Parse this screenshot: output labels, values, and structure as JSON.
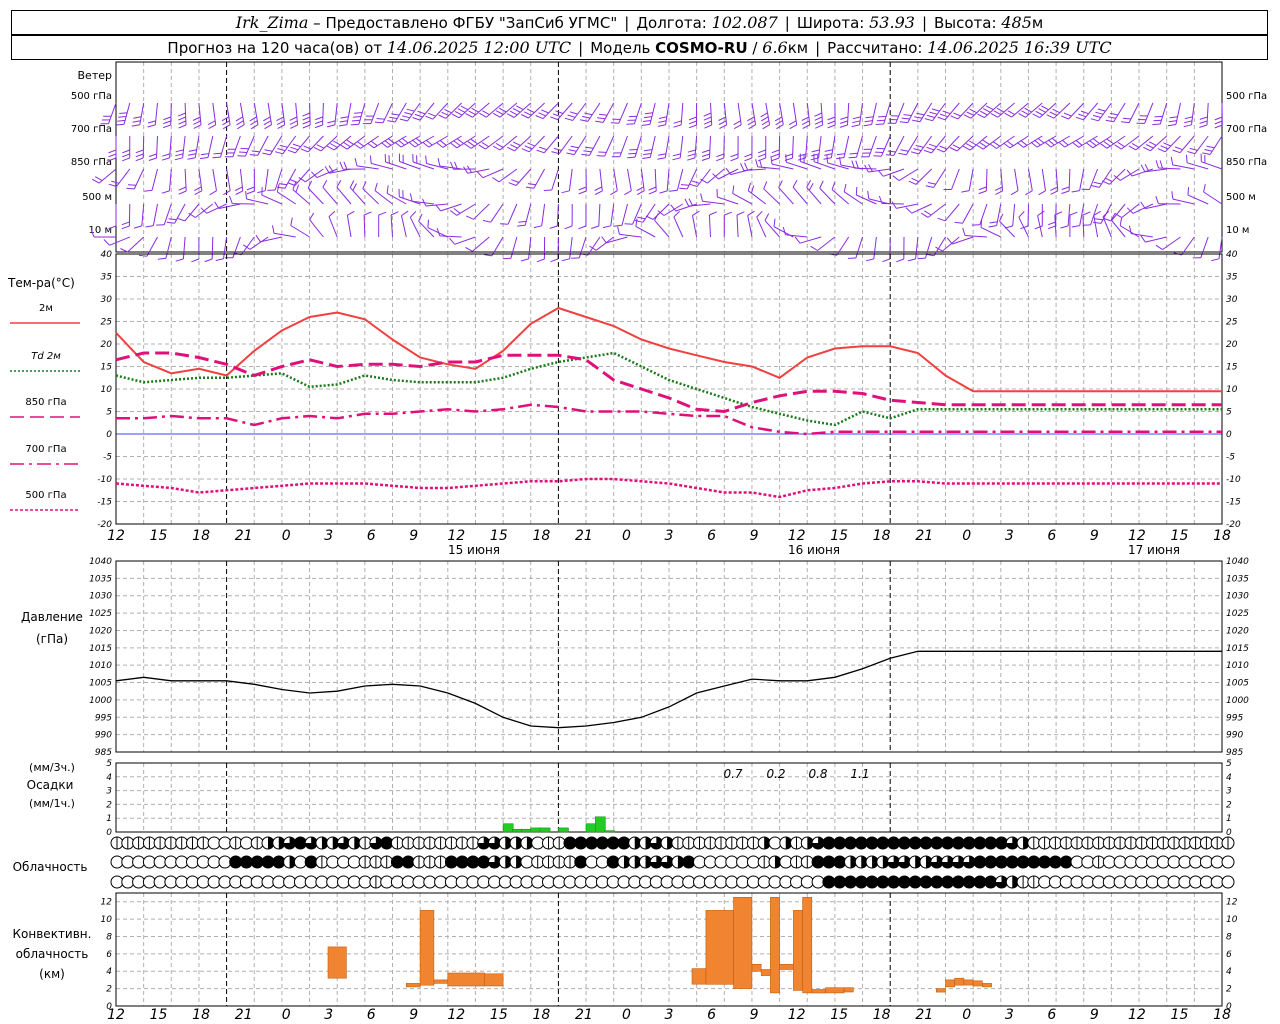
{
  "header": {
    "station": "Irk_Zima",
    "dash": "–",
    "provider": "Предоставлено ФГБУ \"ЗапСиб УГМС\"",
    "lon_label": "Долгота:",
    "lon_value": "102.087",
    "lat_label": "Широта:",
    "lat_value": "53.93",
    "alt_label": "Высота:",
    "alt_value": "485",
    "alt_unit": "м",
    "forecast_prefix": "Прогноз на 120 часа(ов)  от",
    "forecast_start": "14.06.2025 12:00 UTC",
    "model_label": "Модель",
    "model_name": "COSMO-RU",
    "model_slash": "/",
    "model_res": "6.6",
    "model_res_unit": "км",
    "computed_label": "Рассчитано:",
    "computed_value": "14.06.2025 16:39 UTC"
  },
  "colors": {
    "wind": "#8a2be2",
    "t2m": "#f04040",
    "td2m": "#1a7a1a",
    "t850": "#e0107a",
    "t700": "#e0107a",
    "t500": "#e0107a",
    "zero_line": "#4040ff",
    "pressure": "#000000",
    "precip": "#22cc22",
    "convective": "#f08430",
    "grid": "#b0b0b0"
  },
  "time_axis": {
    "hour_labels": [
      "12",
      "15",
      "18",
      "21",
      "0",
      "3",
      "6",
      "9",
      "12",
      "15",
      "18",
      "21",
      "0",
      "3",
      "6",
      "9",
      "12",
      "15",
      "18",
      "21",
      "0",
      "3",
      "6",
      "9",
      "12",
      "15",
      "18"
    ],
    "date_labels": [
      "15 июня",
      "16 июня",
      "17 июня"
    ]
  },
  "wind_panel": {
    "title": "Ветер",
    "levels": [
      "500 гПа",
      "700 гПа",
      "850 гПа",
      "500 м",
      "10 м"
    ]
  },
  "temperature_panel": {
    "title": "Тем-ра(°C)",
    "legend": [
      "2м",
      "Td 2м",
      "850 гПа",
      "700 гПа",
      "500 гПа"
    ],
    "ticks": [
      "40",
      "35",
      "30",
      "25",
      "20",
      "15",
      "10",
      "5",
      "0",
      "-5",
      "-10",
      "-15",
      "-20"
    ]
  },
  "pressure_panel": {
    "title": "Давление",
    "unit": "(гПа)",
    "ticks": [
      "1040",
      "1035",
      "1030",
      "1025",
      "1020",
      "1015",
      "1010",
      "1005",
      "1000",
      "995",
      "990",
      "985"
    ]
  },
  "precip_panel": {
    "unit3h": "(мм/3ч.)",
    "title": "Осадки",
    "unit1h": "(мм/1ч.)",
    "ticks": [
      "5",
      "4",
      "3",
      "2",
      "1",
      "0"
    ],
    "totals": [
      "0.7",
      "0.2",
      "0.8",
      "1.1"
    ]
  },
  "cloud_panel": {
    "title": "Облачность"
  },
  "convective_panel": {
    "title1": "Конвективн.",
    "title2": "облачность",
    "unit": "(км)",
    "ticks": [
      "12",
      "10",
      "8",
      "6",
      "4",
      "2",
      "0"
    ]
  },
  "chart_data": [
    {
      "type": "line",
      "name": "temperature",
      "x": [
        0,
        3,
        6,
        9,
        12,
        15,
        18,
        21,
        24,
        27,
        30,
        33,
        36,
        39,
        42,
        45,
        48,
        51,
        54,
        57,
        60,
        63,
        66,
        69,
        72,
        75,
        78,
        81,
        84,
        87,
        90,
        93,
        96,
        99,
        102,
        105,
        108,
        111,
        114,
        117,
        120
      ],
      "ylim": [
        -20,
        40
      ],
      "series": [
        {
          "name": "2м",
          "values": [
            22.5,
            16,
            13.5,
            14.5,
            13,
            18.5,
            23,
            26,
            27,
            25.5,
            21,
            17,
            15.5,
            14.5,
            18.5,
            24.5,
            28,
            26,
            24,
            21,
            19,
            17.5,
            16,
            15,
            12.5,
            17,
            19,
            19.5,
            19.5,
            18,
            13,
            9.5,
            9.5,
            9.5,
            9.5,
            9.5,
            9.5,
            9.5,
            9.5,
            9.5,
            9.5
          ]
        },
        {
          "name": "Td 2м",
          "values": [
            13,
            11.5,
            12,
            12.5,
            12.5,
            13,
            13.5,
            10.5,
            11,
            13,
            12,
            11.5,
            11.5,
            11.5,
            12.5,
            14.5,
            16,
            17,
            18,
            15,
            12,
            10,
            8,
            6,
            4.5,
            3,
            2,
            5,
            3.5,
            5.5,
            5.5,
            5.5,
            5.5,
            5.5,
            5.5,
            5.5,
            5.5,
            5.5,
            5.5,
            5.5,
            5.5
          ]
        },
        {
          "name": "850 гПа",
          "values": [
            16.5,
            18,
            18,
            17,
            15.5,
            13,
            15,
            16.5,
            15,
            15.5,
            15.5,
            15,
            16,
            16,
            17.5,
            17.5,
            17.5,
            16.5,
            12,
            10,
            8,
            5.5,
            5,
            7,
            8.5,
            9.5,
            9.5,
            9,
            7.5,
            7,
            6.5,
            6.5,
            6.5,
            6.5,
            6.5,
            6.5,
            6.5,
            6.5,
            6.5,
            6.5,
            6.5
          ]
        },
        {
          "name": "700 гПа",
          "values": [
            3.5,
            3.5,
            4,
            3.5,
            3.5,
            2,
            3.5,
            4,
            3.5,
            4.5,
            4.5,
            5,
            5.5,
            5,
            5.5,
            6.5,
            6,
            5,
            5,
            5,
            4.5,
            4,
            4,
            1.5,
            0.5,
            0,
            0.5,
            0.5,
            0.5,
            0.5,
            0.5,
            0.5,
            0.5,
            0.5,
            0.5,
            0.5,
            0.5,
            0.5,
            0.5,
            0.5,
            0.5
          ]
        },
        {
          "name": "500 гПа",
          "values": [
            -11,
            -11.5,
            -12,
            -13,
            -12.5,
            -12,
            -11.5,
            -11,
            -11,
            -11,
            -11.5,
            -12,
            -12,
            -11.5,
            -11,
            -10.5,
            -10.5,
            -10,
            -10,
            -10.5,
            -11,
            -12,
            -13,
            -13,
            -14,
            -12.5,
            -12,
            -11,
            -10.5,
            -10.5,
            -11,
            -11,
            -11,
            -11,
            -11,
            -11,
            -11,
            -11,
            -11,
            -11,
            -11
          ]
        }
      ]
    },
    {
      "type": "line",
      "name": "pressure",
      "x": [
        0,
        3,
        6,
        9,
        12,
        15,
        18,
        21,
        24,
        27,
        30,
        33,
        36,
        39,
        42,
        45,
        48,
        51,
        54,
        57,
        60,
        63,
        66,
        69,
        72,
        75,
        78,
        81,
        84,
        87,
        90,
        93,
        96,
        99,
        102,
        105,
        108,
        111,
        114,
        117,
        120
      ],
      "ylim": [
        985,
        1040
      ],
      "series": [
        {
          "name": "pressure",
          "values": [
            1005.5,
            1006.5,
            1005.5,
            1005.5,
            1005.5,
            1004.5,
            1003,
            1002,
            1002.5,
            1004,
            1004.5,
            1004,
            1002,
            999,
            995,
            992.5,
            992,
            992.5,
            993.5,
            995,
            998,
            1002,
            1004,
            1006,
            1005.5,
            1005.5,
            1006.5,
            1009,
            1012,
            1014,
            1014,
            1014,
            1014,
            1014,
            1014,
            1014,
            1014,
            1014,
            1014,
            1014,
            1014
          ]
        }
      ]
    },
    {
      "type": "bar",
      "name": "precipitation",
      "x": [
        42,
        43,
        44,
        45,
        46,
        47,
        48,
        49,
        50,
        51,
        52,
        53,
        54,
        55
      ],
      "ylim": [
        0,
        5
      ],
      "values": [
        0.6,
        0.2,
        0.2,
        0.3,
        0.3,
        0,
        0.3,
        0,
        0,
        0.6,
        1.1,
        0.1,
        0,
        0
      ],
      "totals": [
        0.7,
        0.2,
        0.8,
        1.1
      ]
    },
    {
      "type": "heatmap",
      "name": "cloudiness",
      "levels": 3,
      "x_step_hours": 1,
      "rows": [
        "22222222200232446864464268222222226644452288888844642222222243424688888888888888888642222222222222222222",
        "00000000000888884082003222882228888644022228008444664800000024022888444466446666888888888002000000000000",
        "00000000000000000000000020000000000000000000000000000000000000000088888888888888886422000000000000000000"
      ]
    },
    {
      "type": "bar",
      "name": "convective cloud",
      "ylim": [
        0,
        13
      ],
      "bars": [
        {
          "x0": 23,
          "x1": 25,
          "base": 3.2,
          "top": 6.8
        },
        {
          "x0": 31.5,
          "x1": 33,
          "base": 2.2,
          "top": 2.6
        },
        {
          "x0": 33,
          "x1": 34.5,
          "base": 2.4,
          "top": 11
        },
        {
          "x0": 34.5,
          "x1": 36,
          "base": 2.6,
          "top": 3
        },
        {
          "x0": 36,
          "x1": 40,
          "base": 2.3,
          "top": 3.8
        },
        {
          "x0": 40,
          "x1": 42,
          "base": 2.3,
          "top": 3.7
        },
        {
          "x0": 62.5,
          "x1": 64,
          "base": 2.5,
          "top": 4.3
        },
        {
          "x0": 64,
          "x1": 67,
          "base": 2.5,
          "top": 11
        },
        {
          "x0": 67,
          "x1": 69,
          "base": 2,
          "top": 12.5
        },
        {
          "x0": 69,
          "x1": 70,
          "base": 4,
          "top": 4.8
        },
        {
          "x0": 70,
          "x1": 71,
          "base": 3.5,
          "top": 4.2
        },
        {
          "x0": 71,
          "x1": 72,
          "base": 1.5,
          "top": 12.5
        },
        {
          "x0": 72,
          "x1": 73.5,
          "base": 4.2,
          "top": 4.8
        },
        {
          "x0": 73.5,
          "x1": 74.5,
          "base": 1.8,
          "top": 11
        },
        {
          "x0": 74.5,
          "x1": 75.5,
          "base": 1.5,
          "top": 12.5
        },
        {
          "x0": 75.5,
          "x1": 77,
          "base": 1.5,
          "top": 1.9
        },
        {
          "x0": 77,
          "x1": 79,
          "base": 1.5,
          "top": 2.1
        },
        {
          "x0": 79,
          "x1": 80,
          "base": 1.6,
          "top": 2.1
        },
        {
          "x0": 89,
          "x1": 90,
          "base": 1.6,
          "top": 2.0
        },
        {
          "x0": 90,
          "x1": 91,
          "base": 2.2,
          "top": 3
        },
        {
          "x0": 91,
          "x1": 92,
          "base": 2.4,
          "top": 3.2
        },
        {
          "x0": 92,
          "x1": 93,
          "base": 2.4,
          "top": 3
        },
        {
          "x0": 93,
          "x1": 94,
          "base": 2.3,
          "top": 2.9
        },
        {
          "x0": 94,
          "x1": 95,
          "base": 2.2,
          "top": 2.6
        }
      ]
    }
  ]
}
